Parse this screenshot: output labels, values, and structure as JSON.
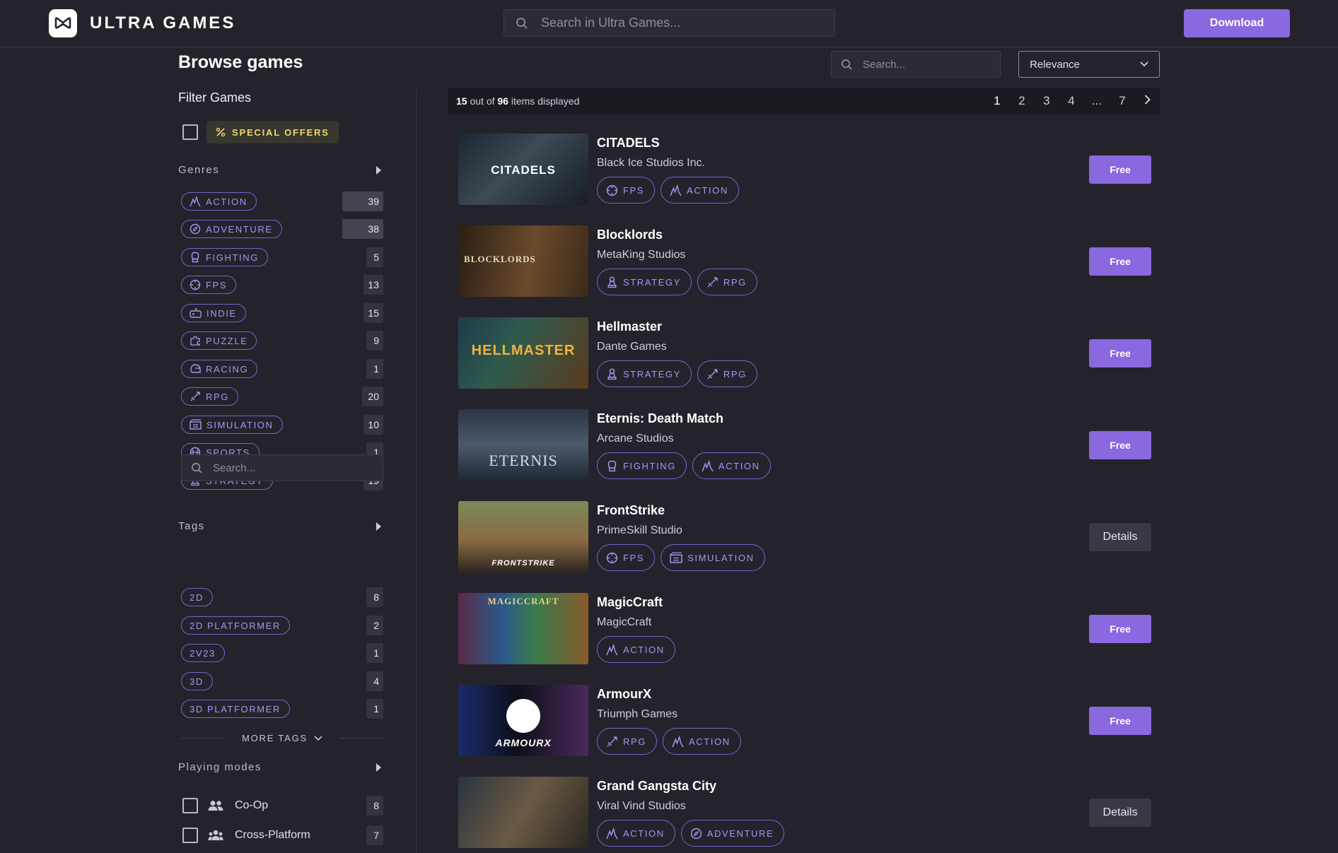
{
  "header": {
    "brand": "ULTRA GAMES",
    "search_placeholder": "Search in Ultra Games...",
    "download_label": "Download"
  },
  "browse": {
    "title": "Browse games",
    "search_placeholder": "Search...",
    "sort_value": "Relevance"
  },
  "sidebar": {
    "filter_title": "Filter Games",
    "special_offers": "SPECIAL OFFERS",
    "genres_title": "Genres",
    "genres": [
      {
        "label": "ACTION",
        "count": "39",
        "icon": "action-icon"
      },
      {
        "label": "ADVENTURE",
        "count": "38",
        "icon": "compass-icon"
      },
      {
        "label": "FIGHTING",
        "count": "5",
        "icon": "glove-icon"
      },
      {
        "label": "FPS",
        "count": "13",
        "icon": "crosshair-icon"
      },
      {
        "label": "INDIE",
        "count": "15",
        "icon": "gamepad-icon"
      },
      {
        "label": "PUZZLE",
        "count": "9",
        "icon": "puzzle-icon"
      },
      {
        "label": "RACING",
        "count": "1",
        "icon": "helmet-icon"
      },
      {
        "label": "RPG",
        "count": "20",
        "icon": "sword-icon"
      },
      {
        "label": "SIMULATION",
        "count": "10",
        "icon": "simulation-icon"
      },
      {
        "label": "SPORTS",
        "count": "1",
        "icon": "ball-icon"
      },
      {
        "label": "STRATEGY",
        "count": "19",
        "icon": "pawn-icon"
      }
    ],
    "tags_title": "Tags",
    "tags_search_placeholder": "Search...",
    "tags": [
      {
        "label": "2D",
        "count": "8"
      },
      {
        "label": "2D PLATFORMER",
        "count": "2"
      },
      {
        "label": "2V23",
        "count": "1"
      },
      {
        "label": "3D",
        "count": "4"
      },
      {
        "label": "3D PLATFORMER",
        "count": "1"
      }
    ],
    "more_tags": "MORE TAGS",
    "modes_title": "Playing modes",
    "modes": [
      {
        "label": "Co-Op",
        "count": "8"
      },
      {
        "label": "Cross-Platform",
        "count": "7"
      }
    ]
  },
  "list": {
    "displayed": "15",
    "out_of": "out of",
    "total": "96",
    "items_displayed": "items displayed",
    "pages": [
      "1",
      "2",
      "3",
      "4",
      "...",
      "7"
    ],
    "games": [
      {
        "title": "CITADELS",
        "studio": "Black Ice Studios Inc.",
        "tags": [
          "FPS",
          "ACTION"
        ],
        "action": "Free",
        "thumb_text": "CITADELS"
      },
      {
        "title": "Blocklords",
        "studio": "MetaKing Studios",
        "tags": [
          "STRATEGY",
          "RPG"
        ],
        "action": "Free",
        "thumb_text": "BLOCKLORDS"
      },
      {
        "title": "Hellmaster",
        "studio": "Dante Games",
        "tags": [
          "STRATEGY",
          "RPG"
        ],
        "action": "Free",
        "thumb_text": "HELLMASTER"
      },
      {
        "title": "Eternis: Death Match",
        "studio": "Arcane Studios",
        "tags": [
          "FIGHTING",
          "ACTION"
        ],
        "action": "Free",
        "thumb_text": "ETERNIS"
      },
      {
        "title": "FrontStrike",
        "studio": "PrimeSkill Studio",
        "tags": [
          "FPS",
          "SIMULATION"
        ],
        "action": "Details",
        "thumb_text": "FRONTSTRIKE"
      },
      {
        "title": "MagicCraft",
        "studio": "MagicCraft",
        "tags": [
          "ACTION"
        ],
        "action": "Free",
        "thumb_text": "MAGICCRAFT"
      },
      {
        "title": "ArmourX",
        "studio": "Triumph Games",
        "tags": [
          "RPG",
          "ACTION"
        ],
        "action": "Free",
        "thumb_text": "ARMOURX"
      },
      {
        "title": "Grand Gangsta City",
        "studio": "Viral Vind Studios",
        "tags": [
          "ACTION",
          "ADVENTURE"
        ],
        "action": "Details",
        "thumb_text": ""
      }
    ]
  },
  "colors": {
    "accent": "#8a68e0",
    "chip_border": "#7a62cc",
    "chip_text": "#a994f0",
    "background": "#24232c",
    "offer_text": "#f0d46f"
  }
}
